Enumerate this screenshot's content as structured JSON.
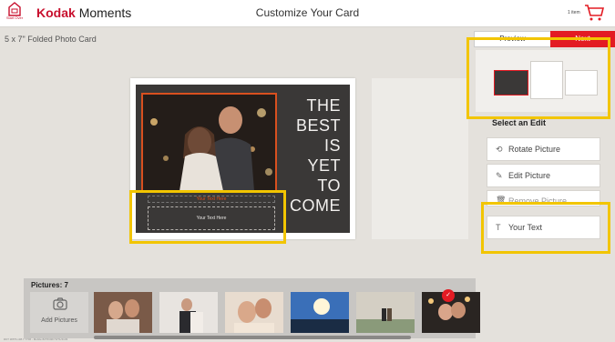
{
  "header": {
    "start_over_label": "Start Over",
    "brand_kodak": "Kodak",
    "brand_moments": "Moments",
    "title": "Customize Your Card",
    "cart_count": "1 item"
  },
  "card_size": "5 x 7\" Folded Photo Card",
  "card": {
    "quote_lines": [
      "THE",
      "BEST",
      "IS",
      "YET",
      "TO",
      "COME"
    ],
    "ghost_text": "Your Text Here",
    "text_placeholder": "Your Text Here"
  },
  "right_panel": {
    "preview_label": "Preview",
    "next_label": "Next",
    "select_edit_title": "Select an Edit",
    "edits": [
      {
        "label": "Rotate Picture",
        "icon": "rotate-icon"
      },
      {
        "label": "Edit Picture",
        "icon": "edit-icon"
      },
      {
        "label": "Remove Picture",
        "icon": "trash-icon"
      },
      {
        "label": "Your Text",
        "icon": "text-icon"
      }
    ]
  },
  "pictures": {
    "label": "Pictures: 7",
    "add_label": "Add Pictures"
  },
  "footer_note": "DKT 3PPS v38.7.7706 - Mobile 8276/32F73/71/4133",
  "colors": {
    "brand_red": "#e31b23",
    "highlight": "#f2c500",
    "card_dark": "#3a3837",
    "photo_border": "#d9501f"
  }
}
